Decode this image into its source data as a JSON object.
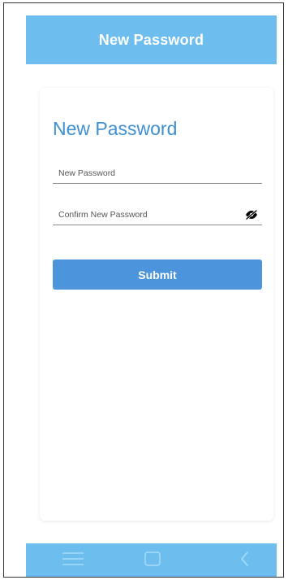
{
  "header": {
    "title": "New Password"
  },
  "form": {
    "title": "New Password",
    "new_password": {
      "placeholder": "New Password",
      "value": ""
    },
    "confirm_password": {
      "placeholder": "Confirm New Password",
      "value": "",
      "visibility_icon": "eye-off-icon"
    },
    "submit_label": "Submit"
  },
  "nav": {
    "menu_icon": "menu-icon",
    "home_icon": "square-home-icon",
    "back_icon": "chevron-left-icon"
  },
  "colors": {
    "header_bg": "#6dbdef",
    "title_blue": "#3f8fd3",
    "button_blue": "#4c94dc",
    "nav_bg": "#6dbdef"
  }
}
